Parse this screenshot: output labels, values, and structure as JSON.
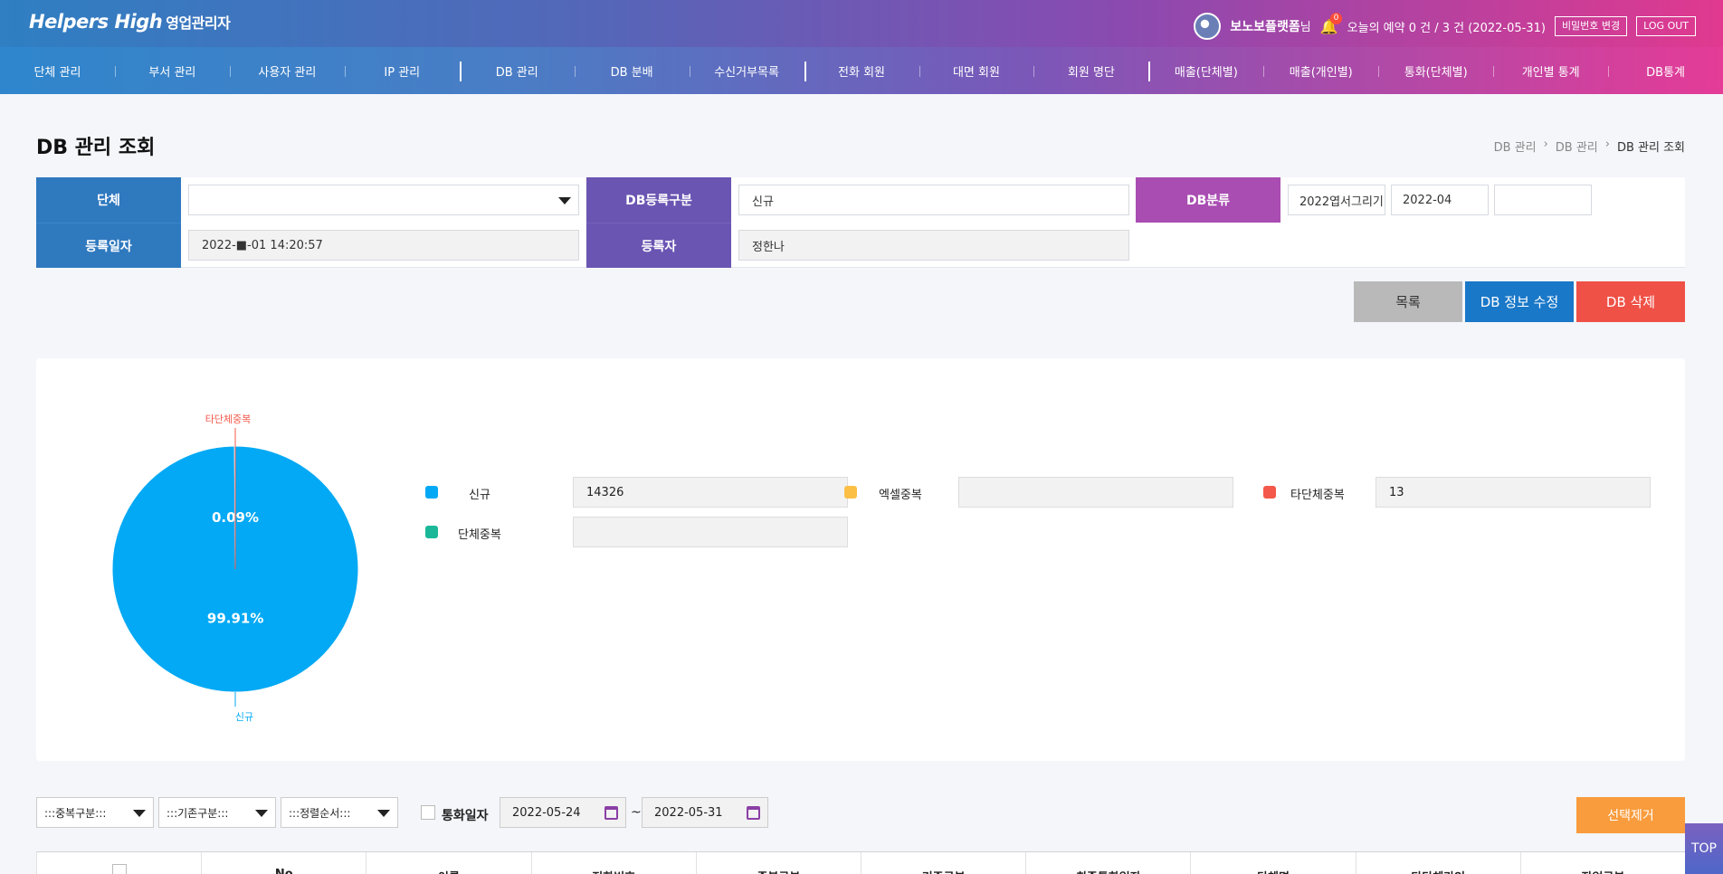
{
  "header": {
    "logo_main": "Helpers High",
    "logo_sub": "영업관리자",
    "user_name": "보노보플랫폼",
    "user_suffix": "님",
    "notif_count": "0",
    "reservation_text": "오늘의 예약 0 건 / 3 건 (2022-05-31)",
    "change_password": "비밀번호 변경",
    "logout": "LOG OUT"
  },
  "nav": {
    "items": [
      "단체 관리",
      "부서 관리",
      "사용자 관리",
      "IP 관리",
      "DB 관리",
      "DB 분배",
      "수신거부목록",
      "전화 회원",
      "대면 회원",
      "회원 명단",
      "매출(단체별)",
      "매출(개인별)",
      "통화(단체별)",
      "개인별 통계",
      "DB통계"
    ]
  },
  "page": {
    "title": "DB 관리 조회",
    "breadcrumb": [
      "DB 관리",
      "DB 관리",
      "DB 관리 조회"
    ]
  },
  "form": {
    "group_label": "단체",
    "group_value": "",
    "db_type_label": "DB등록구분",
    "db_type_value": "신규",
    "db_class_label": "DB분류",
    "db_class_values": [
      "2022엽서그리기",
      "2022-04",
      ""
    ],
    "reg_date_label": "등록일자",
    "reg_date_value": "2022-■-01 14:20:57",
    "registrant_label": "등록자",
    "registrant_value": "정한나"
  },
  "actions": {
    "list": "목록",
    "edit": "DB 정보 수정",
    "delete": "DB 삭제"
  },
  "colors": {
    "label_blue": "#2f79bf",
    "label_purple": "#6a55b2",
    "label_magenta": "#a94db2",
    "btn_gray": "#b9b9b9",
    "btn_blue": "#1a78c8",
    "btn_red": "#ef5147",
    "new": "#03a9f4",
    "excel_dup": "#fbbf45",
    "other_dup": "#f4584a",
    "group_dup": "#1ab899"
  },
  "chart_data": {
    "type": "pie",
    "slices": [
      {
        "name": "신규",
        "value": 14326,
        "percent_label": "99.91%"
      },
      {
        "name": "타단체중복",
        "value": 13,
        "percent_label": "0.09%"
      }
    ],
    "legend": [
      {
        "name": "신규",
        "value": "14326"
      },
      {
        "name": "엑셀중복",
        "value": ""
      },
      {
        "name": "타단체중복",
        "value": "13"
      },
      {
        "name": "단체중복",
        "value": ""
      }
    ]
  },
  "filters": {
    "dup_select": ":::중복구분:::",
    "exist_select": ":::기존구분:::",
    "sort_select": ":::정렬순서:::",
    "call_date_label": "통화일자",
    "date_from": "2022-05-24",
    "tilde": "~",
    "date_to": "2022-05-31",
    "remove_selected": "선택제거"
  },
  "table": {
    "headers": [
      "",
      "No",
      "이름",
      "전화번호",
      "중복구분",
      "기존구분",
      "최종통화일자",
      "단체명",
      "타단체라인",
      "작업구분"
    ]
  },
  "top_button": "TOP"
}
